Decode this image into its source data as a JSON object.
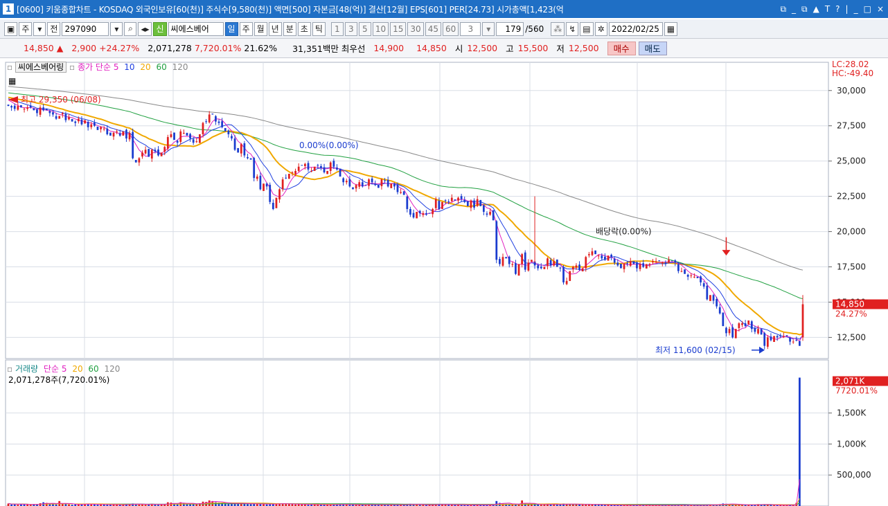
{
  "window": {
    "num": "1",
    "title": "[0600] 키움종합차트 - KOSDAQ 외국인보유[60(천)] 주식수[9,580(천)] 액면[500] 자본금[48(억)] 결산[12월] EPS[601] PER[24.73] 시가총액[1,423(억",
    "controls": [
      "⧉",
      "_",
      "⧉",
      "▲",
      "T",
      "?",
      "|",
      "_",
      "□",
      "×"
    ]
  },
  "toolbar": {
    "period_label": "주",
    "jeon_label": "전",
    "code": "297090",
    "sin_label": "신",
    "stock_name": "씨에스베어",
    "periods": [
      "일",
      "주",
      "월",
      "년",
      "분",
      "초",
      "틱"
    ],
    "intervals": [
      "1",
      "3",
      "5",
      "10",
      "15",
      "30",
      "45",
      "60"
    ],
    "count_value": "3",
    "range_value": "179",
    "range_total": "/560",
    "date": "2022/02/25"
  },
  "info": {
    "price": "14,850 ▲",
    "change": "2,900 +24.27%",
    "volume": "2,071,278",
    "vol_ratio": "7,720.01%",
    "turnover": "21.62%",
    "amount": "31,351백만",
    "best_label": "최우선",
    "best_ask": "14,900",
    "best_bid": "14,850",
    "open_label": "시",
    "open": "12,500",
    "high_label": "고",
    "high": "15,500",
    "low_label": "저",
    "low": "12,500",
    "buy_label": "매수",
    "sell_label": "매도"
  },
  "colors": {
    "up": "#e02020",
    "down": "#1a3ccf",
    "ma5": "#e020c0",
    "ma10": "#2040e0",
    "ma20": "#f0a800",
    "ma60": "#20a040",
    "ma120": "#888888",
    "grid": "#d8dde6"
  },
  "price_panel": {
    "legend": {
      "name": "씨에스베어링",
      "ind": "종가 단순",
      "p5": "5",
      "p10": "10",
      "p20": "20",
      "p60": "60",
      "p120": "120"
    },
    "lc": "LC:28.02",
    "hc": "HC:-49.40",
    "current_price": "14,850",
    "current_change": "24.27%",
    "annotations": {
      "high": "최고 29,350 (06/08)",
      "low": "최저 11,600 (02/15)",
      "fib": "0.00%(0.00%)",
      "dividend": "배당락(0.00%)"
    }
  },
  "volume_panel": {
    "legend": {
      "name": "거래량",
      "ind": "단순",
      "p5": "5",
      "p20": "20",
      "p60": "60",
      "p120": "120"
    },
    "value_text": "2,071,278주(7,720.01%)",
    "current": "2,071K",
    "current_ratio": "7720.01%"
  },
  "chart_data": {
    "type": "candlestick",
    "price_axis": {
      "min": 11000,
      "max": 32000,
      "ticks": [
        12500,
        15000,
        17500,
        20000,
        22500,
        25000,
        27500,
        30000
      ],
      "tick_labels": [
        "12,500",
        "15,000",
        "17,500",
        "20,000",
        "22,500",
        "25,000",
        "27,500",
        "30,000"
      ]
    },
    "volume_axis": {
      "min": 0,
      "max": 2200000,
      "ticks": [
        500000,
        1000000,
        1500000
      ],
      "tick_labels": [
        "500,000",
        "1,000K",
        "1,500K"
      ]
    },
    "closes": [
      28900,
      28800,
      28700,
      28900,
      28800,
      28700,
      28800,
      28800,
      28600,
      28400,
      28800,
      28600,
      28600,
      28400,
      28300,
      28000,
      28200,
      28400,
      27900,
      28100,
      27800,
      27700,
      28000,
      27600,
      27900,
      27400,
      27600,
      27500,
      27200,
      27400,
      27300,
      26900,
      26800,
      27000,
      27100,
      26800,
      27100,
      26600,
      27000,
      25200,
      24900,
      25200,
      25600,
      25800,
      25300,
      25800,
      25700,
      25400,
      25600,
      26000,
      26700,
      26900,
      26500,
      26300,
      27100,
      27000,
      26800,
      26600,
      26300,
      26400,
      26900,
      27700,
      27800,
      28300,
      28300,
      27800,
      27700,
      27400,
      27100,
      26900,
      26600,
      25800,
      25600,
      26200,
      25400,
      25200,
      25100,
      23800,
      23900,
      23000,
      23400,
      23200,
      22100,
      21600,
      22400,
      23000,
      23700,
      23800,
      24100,
      24200,
      24300,
      24600,
      24700,
      24800,
      24400,
      24300,
      24600,
      24700,
      24500,
      24200,
      24300,
      24900,
      24600,
      24400,
      23900,
      23500,
      23600,
      23200,
      23000,
      23300,
      23500,
      23200,
      23300,
      23700,
      23500,
      23300,
      23100,
      23700,
      23600,
      23200,
      23400,
      23200,
      22800,
      22800,
      22600,
      21600,
      21200,
      21000,
      21400,
      21300,
      21300,
      21200,
      21300,
      21600,
      22300,
      21600,
      22100,
      22200,
      22100,
      22400,
      22200,
      22400,
      22300,
      22100,
      21800,
      22200,
      21700,
      22300,
      21800,
      21400,
      21200,
      21400,
      20800,
      18000,
      17700,
      18200,
      18100,
      17700,
      17700,
      17000,
      17700,
      18400,
      17300,
      17800,
      18000,
      17600,
      17400,
      17400,
      17500,
      18100,
      17600,
      17900,
      17500,
      17400,
      16400,
      16500,
      17200,
      17500,
      17600,
      17300,
      17400,
      18200,
      18400,
      18600,
      18400,
      18300,
      18100,
      18000,
      18300,
      18200,
      17800,
      17600,
      17400,
      17700,
      17700,
      17900,
      17700,
      17400,
      17700,
      17500,
      17700,
      17700,
      17900,
      17900,
      17900,
      17800,
      17700,
      18000,
      17900,
      17800,
      17200,
      17200,
      17000,
      16800,
      16900,
      16800,
      16700,
      16400,
      16100,
      15200,
      15500,
      15100,
      14700,
      14200,
      13300,
      12800,
      13100,
      12500,
      13100,
      13500,
      13500,
      13300,
      13700,
      13100,
      12900,
      13100,
      12700,
      11900,
      12500,
      12300,
      12600,
      12500,
      12600,
      12600,
      12600,
      12200,
      12200,
      12300,
      11900,
      14850
    ],
    "ohlc_note": "",
    "dividend_index": 225,
    "volumes": [
      40000,
      25000,
      30000,
      20000,
      35000,
      28000,
      22000,
      18000,
      30000,
      25000,
      45000,
      60000,
      50000,
      30000,
      35000,
      25000,
      80000,
      40000,
      30000,
      25000,
      20000,
      30000,
      28000,
      25000,
      35000,
      30000,
      25000,
      22000,
      20000,
      30000,
      25000,
      20000,
      18000,
      25000,
      22000,
      20000,
      18000,
      25000,
      30000,
      40000,
      30000,
      25000,
      22000,
      20000,
      30000,
      35000,
      25000,
      20000,
      22000,
      28000,
      60000,
      55000,
      40000,
      30000,
      60000,
      50000,
      40000,
      35000,
      30000,
      30000,
      45000,
      70000,
      65000,
      90000,
      80000,
      60000,
      55000,
      50000,
      45000,
      40000,
      35000,
      50000,
      40000,
      45000,
      35000,
      30000,
      28000,
      40000,
      35000,
      30000,
      28000,
      25000,
      35000,
      40000,
      30000,
      35000,
      40000,
      35000,
      30000,
      28000,
      25000,
      30000,
      28000,
      25000,
      20000,
      22000,
      25000,
      22000,
      20000,
      18000,
      20000,
      28000,
      22000,
      20000,
      25000,
      28000,
      22000,
      20000,
      18000,
      20000,
      22000,
      18000,
      20000,
      25000,
      22000,
      20000,
      18000,
      22000,
      20000,
      18000,
      20000,
      18000,
      22000,
      20000,
      18000,
      30000,
      35000,
      25000,
      22000,
      20000,
      18000,
      16000,
      18000,
      22000,
      30000,
      25000,
      22000,
      20000,
      18000,
      22000,
      20000,
      18000,
      16000,
      15000,
      16000,
      18000,
      16000,
      18000,
      16000,
      15000,
      16000,
      18000,
      20000,
      80000,
      50000,
      40000,
      35000,
      30000,
      28000,
      35000,
      30000,
      90000,
      40000,
      30000,
      28000,
      25000,
      22000,
      20000,
      25000,
      30000,
      25000,
      22000,
      20000,
      25000,
      40000,
      35000,
      30000,
      28000,
      25000,
      22000,
      20000,
      30000,
      28000,
      25000,
      22000,
      20000,
      18000,
      16000,
      18000,
      16000,
      15000,
      14000,
      15000,
      16000,
      15000,
      14000,
      13000,
      14000,
      15000,
      14000,
      13000,
      12000,
      14000,
      15000,
      14000,
      13000,
      12000,
      16000,
      15000,
      14000,
      20000,
      18000,
      16000,
      15000,
      14000,
      13000,
      12000,
      14000,
      16000,
      25000,
      22000,
      20000,
      18000,
      30000,
      40000,
      35000,
      30000,
      28000,
      25000,
      22000,
      20000,
      18000,
      16000,
      20000,
      22000,
      30000,
      25000,
      22000,
      20000,
      18000,
      16000,
      15000,
      14000,
      13000,
      12000,
      14000,
      15000,
      50000,
      2071278
    ]
  }
}
